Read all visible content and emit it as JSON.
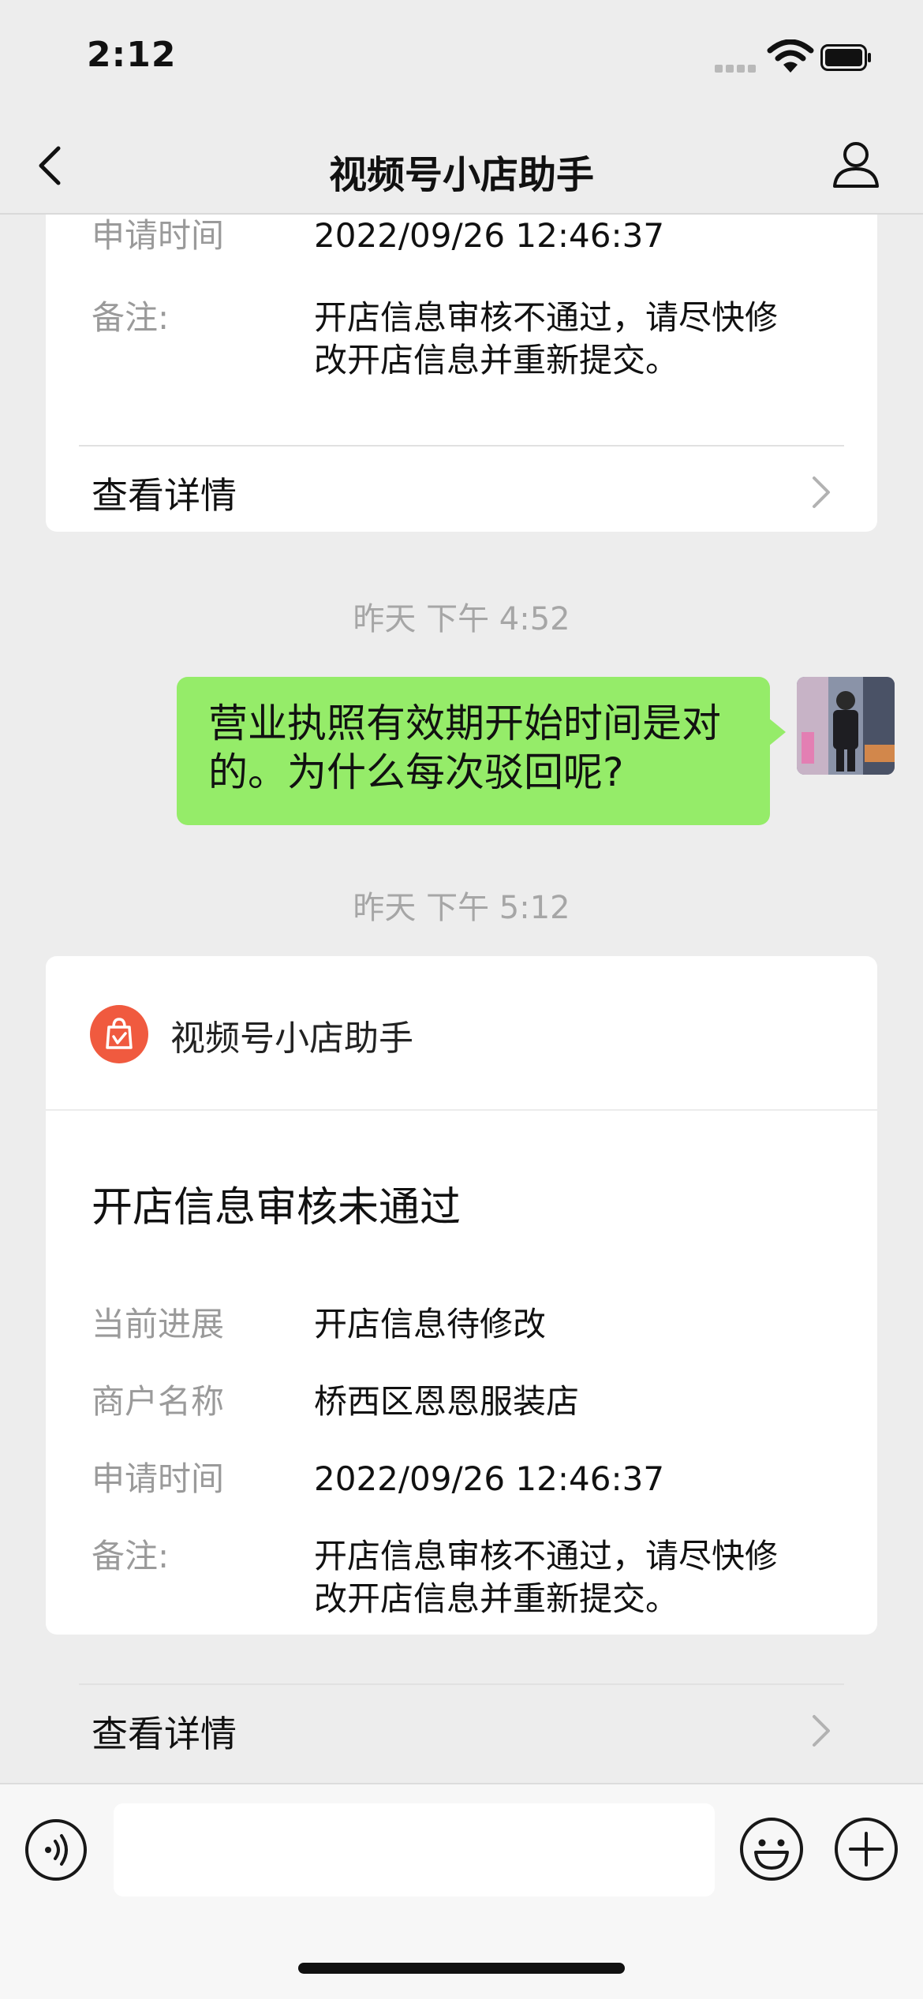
{
  "status": {
    "time": "2:12"
  },
  "nav": {
    "title": "视频号小店助手"
  },
  "top_card": {
    "time_label": "申请时间",
    "time_value": "2022/09/26 12:46:37",
    "note_label": "备注:",
    "note_line1": "开店信息审核不通过，请尽快修",
    "note_line2": "改开店信息并重新提交。",
    "details": "查看详情"
  },
  "timestamps": {
    "first": "昨天 下午 4:52",
    "second": "昨天 下午 5:12"
  },
  "message": {
    "line1": "营业执照有效期开始时间是对",
    "line2": "的。为什么每次驳回呢?"
  },
  "bottom_card": {
    "brand": "视频号小店助手",
    "title": "开店信息审核未通过",
    "rows": [
      {
        "label": "当前进展",
        "value": "开店信息待修改"
      },
      {
        "label": "商户名称",
        "value": "桥西区恩恩服装店"
      },
      {
        "label": "申请时间",
        "value": "2022/09/26 12:46:37"
      }
    ],
    "note_label": "备注:",
    "note_line1": "开店信息审核不通过，请尽快修",
    "note_line2": "改开店信息并重新提交。",
    "details": "查看详情"
  },
  "colors": {
    "bubble": "#95ec69",
    "brand": "#f05a3f",
    "background": "#ededed"
  }
}
